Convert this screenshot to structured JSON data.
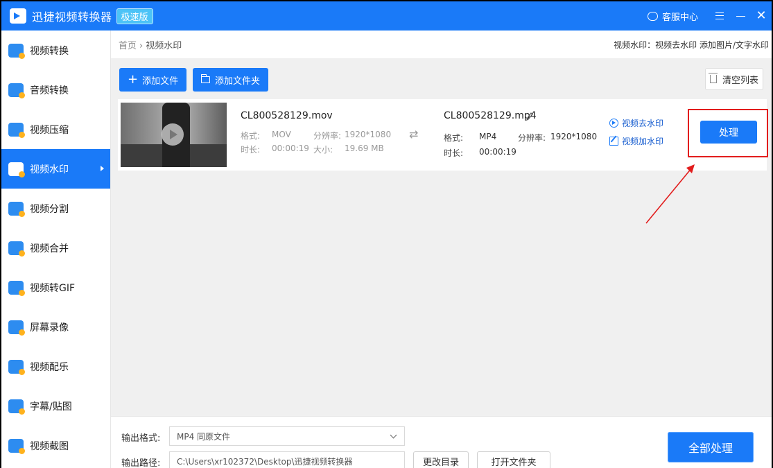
{
  "app": {
    "title": "迅捷视频转换器",
    "edition": "极速版",
    "support_label": "客服中心"
  },
  "sidebar": {
    "items": [
      {
        "label": "视频转换",
        "icon": "video-convert-icon",
        "active": false
      },
      {
        "label": "音频转换",
        "icon": "audio-convert-icon",
        "active": false
      },
      {
        "label": "视频压缩",
        "icon": "video-compress-icon",
        "active": false
      },
      {
        "label": "视频水印",
        "icon": "video-watermark-icon",
        "active": true
      },
      {
        "label": "视频分割",
        "icon": "video-split-icon",
        "active": false
      },
      {
        "label": "视频合并",
        "icon": "video-merge-icon",
        "active": false
      },
      {
        "label": "视频转GIF",
        "icon": "video-gif-icon",
        "active": false
      },
      {
        "label": "屏幕录像",
        "icon": "screen-record-icon",
        "active": false
      },
      {
        "label": "视频配乐",
        "icon": "video-music-icon",
        "active": false
      },
      {
        "label": "字幕/贴图",
        "icon": "subtitle-sticker-icon",
        "active": false
      },
      {
        "label": "视频截图",
        "icon": "video-screenshot-icon",
        "active": false
      }
    ]
  },
  "breadcrumb": {
    "home": "首页",
    "separator": "›",
    "current": "视频水印"
  },
  "header_info": "视频水印：视频去水印 添加图片/文字水印",
  "toolbar": {
    "add_file": "添加文件",
    "add_folder": "添加文件夹",
    "clear_list": "清空列表"
  },
  "file": {
    "source": {
      "name": "CL800528129.mov",
      "format_label": "格式:",
      "format": "MOV",
      "resolution_label": "分辨率:",
      "resolution": "1920*1080",
      "duration_label": "时长:",
      "duration": "00:00:19",
      "size_label": "大小:",
      "size": "19.69 MB"
    },
    "output": {
      "name": "CL800528129.mp4",
      "format_label": "格式:",
      "format": "MP4",
      "resolution_label": "分辨率:",
      "resolution": "1920*1080",
      "duration_label": "时长:",
      "duration": "00:00:19"
    },
    "actions": {
      "remove_watermark": "视频去水印",
      "add_watermark": "视频加水印",
      "process": "处理"
    }
  },
  "bottom": {
    "output_format_label": "输出格式:",
    "output_format_value": "MP4  同原文件",
    "output_path_label": "输出路径:",
    "output_path_value": "C:\\Users\\xr102372\\Desktop\\迅捷视频转换器",
    "change_dir": "更改目录",
    "open_folder": "打开文件夹",
    "process_all": "全部处理"
  },
  "colors": {
    "accent": "#1a7af8",
    "highlight": "#e21d1d"
  }
}
